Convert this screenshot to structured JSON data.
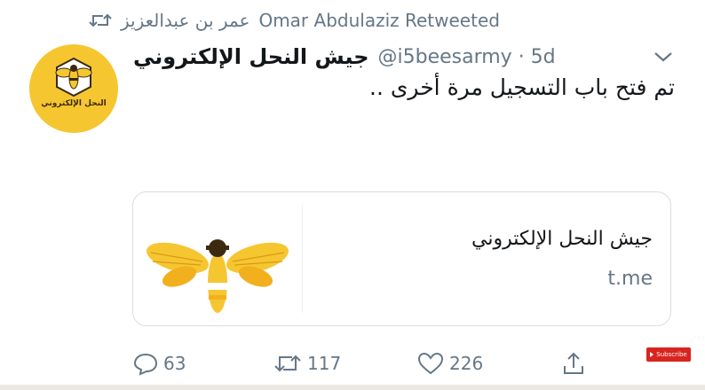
{
  "retweet": {
    "icon": "retweet-icon",
    "retweeter_arabic": "عمر بن عبدالعزيز",
    "retweeter_latin": "Omar Abdulaziz Retweeted"
  },
  "avatar": {
    "label": "النحل الإلكتروني",
    "bg_color": "#f6c631"
  },
  "tweet": {
    "display_name": "جيش النحل الإلكتروني",
    "handle_time": "@i5beesarmy · 5d",
    "text": "تم فتح باب التسجيل مرة أخرى ..",
    "menu_icon": "chevron-down-icon"
  },
  "card": {
    "title": "جيش النحل الإلكتروني",
    "domain": "t.me",
    "image_icon": "bee-icon"
  },
  "actions": {
    "reply_count": "63",
    "retweet_count": "117",
    "like_count": "226",
    "reply_icon": "reply-icon",
    "retweet_icon": "retweet-icon",
    "like_icon": "heart-icon",
    "share_icon": "share-icon"
  },
  "overlay": {
    "subscribe_label": "Subscribe"
  },
  "colors": {
    "accent_gray": "#657786",
    "text": "#14171a",
    "border": "#d6dde3",
    "bee_yellow": "#f6c631"
  }
}
